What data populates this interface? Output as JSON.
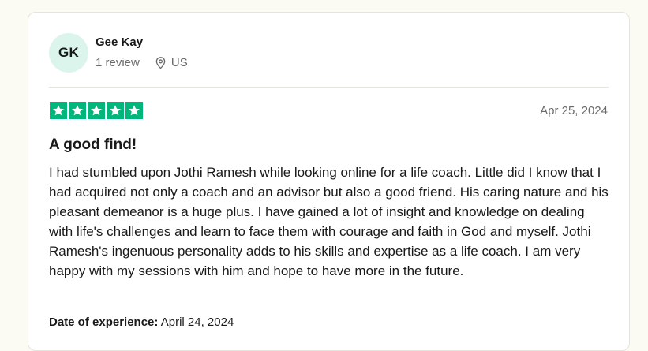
{
  "reviewer": {
    "initials": "GK",
    "name": "Gee Kay",
    "review_count": "1 review",
    "location": "US"
  },
  "review": {
    "rating": 5,
    "max_rating": 5,
    "date": "Apr 25, 2024",
    "title": "A good find!",
    "body": "I had stumbled upon Jothi Ramesh while looking online for a life coach. Little did I know that I had acquired not only a coach and an advisor but also a good friend. His caring nature and his pleasant demeanor is a huge plus. I have gained a lot of insight and knowledge on dealing with life's challenges and learn to face them with courage and faith in God and myself. Jothi Ramesh's ingenuous personality adds to his skills and expertise as a life coach. I am very happy with my sessions with him and hope to have more in the future.",
    "experience_label": "Date of experience:",
    "experience_date": "April 24, 2024"
  },
  "icons": {
    "location": "location-pin-icon",
    "star": "star-icon"
  },
  "colors": {
    "star_fill": "#00b67a",
    "avatar_bg": "#dcf5ec",
    "muted_text": "#6b6b6b"
  }
}
